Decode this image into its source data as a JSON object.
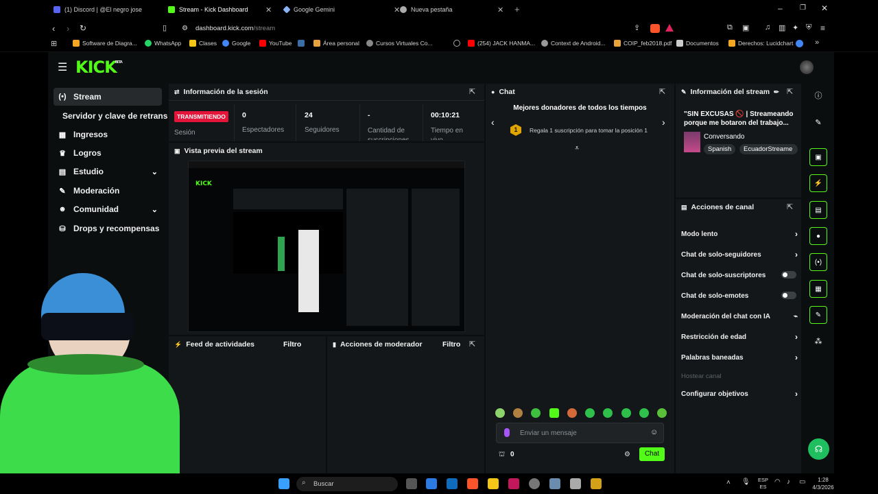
{
  "browser": {
    "tabs": [
      {
        "label": "(1) Discord | @El negro jose",
        "icon": "discord-icon",
        "color": "#5865f2"
      },
      {
        "label": "Stream - Kick Dashboard",
        "icon": "kick-icon",
        "color": "#53fc18"
      },
      {
        "label": "Google Gemini",
        "icon": "gemini-icon",
        "color": "#8ab4f8"
      },
      {
        "label": "Nueva pestaña",
        "icon": "brave-icon",
        "color": "#aaaaaa"
      }
    ],
    "url_domain": "dashboard.kick.com",
    "url_path": "/stream",
    "bookmarks": [
      {
        "label": "Software de Diagra...",
        "color": "#f5a623"
      },
      {
        "label": "WhatsApp",
        "color": "#25d366"
      },
      {
        "label": "Clases",
        "color": "#f5c518"
      },
      {
        "label": "Google",
        "color": "#4285f4"
      },
      {
        "label": "YouTube",
        "color": "#ff0000"
      },
      {
        "label": "",
        "color": "#3a6ea5"
      },
      {
        "label": "Área personal",
        "color": "#e8a33d"
      },
      {
        "label": "Cursos Virtuales Co...",
        "color": "#888888"
      },
      {
        "label": "(254) JACK HANMA...",
        "color": "#ff0000"
      },
      {
        "label": "Context de Android...",
        "color": "#999999"
      },
      {
        "label": "COIP_feb2018.pdf",
        "color": "#e8a33d"
      },
      {
        "label": "Documentos",
        "color": "#cccccc"
      },
      {
        "label": "Derechos: Lucidchart",
        "color": "#f5a623"
      }
    ]
  },
  "sidebar": {
    "items": [
      {
        "label": "Stream",
        "icon": "stream-icon",
        "glyph": "(•)"
      },
      {
        "label": "Servidor y clave de retransm",
        "icon": "",
        "glyph": ""
      },
      {
        "label": "Ingresos",
        "icon": "revenue-icon",
        "glyph": "▦"
      },
      {
        "label": "Logros",
        "icon": "trophy-icon",
        "glyph": "🏆"
      },
      {
        "label": "Estudio",
        "icon": "studio-icon",
        "glyph": "▤"
      },
      {
        "label": "Moderación",
        "icon": "wrench-icon",
        "glyph": "🔧"
      },
      {
        "label": "Comunidad",
        "icon": "community-icon",
        "glyph": "👤"
      },
      {
        "label": "Drops y recompensas",
        "icon": "drops-icon",
        "glyph": "⛁"
      }
    ]
  },
  "session": {
    "title": "Información de la sesión",
    "live_badge": "TRANSMITIENDO",
    "live_label": "Sesión",
    "stats": [
      {
        "value": "0",
        "label": "Espectadores"
      },
      {
        "value": "24",
        "label": "Seguidores"
      },
      {
        "value": "-",
        "label": "Cantidad de suscripciones"
      },
      {
        "value": "00:10:21",
        "label": "Tiempo en vivo"
      }
    ]
  },
  "preview": {
    "title": "Vista previa del stream"
  },
  "activity": {
    "title": "Feed de actividades",
    "filter": "Filtro"
  },
  "moderator": {
    "title": "Acciones de moderador",
    "filter": "Filtro"
  },
  "chat": {
    "title": "Chat",
    "donors_title": "Mejores donadores de todos los tiempos",
    "rank": "1",
    "donor_text": "Regala 1 suscripción para tomar la posición 1",
    "input_placeholder": "Enviar un mensaje",
    "points": "0",
    "send_label": "Chat"
  },
  "stream_info": {
    "title": "Información del stream",
    "stream_title": "\"SIN EXCUSAS 🚫 | Streameando porque me botaron del trabajo...",
    "category": "Conversando",
    "tags": [
      "Spanish",
      "EcuadorStreame"
    ]
  },
  "channel_actions": {
    "title": "Acciones de canal",
    "rows": [
      {
        "label": "Modo lento",
        "control": "chevron"
      },
      {
        "label": "Chat de solo-seguidores",
        "control": "chevron"
      },
      {
        "label": "Chat de solo-suscriptores",
        "control": "toggle"
      },
      {
        "label": "Chat de solo-emotes",
        "control": "toggle"
      },
      {
        "label": "Moderación del chat con IA",
        "control": "chart"
      },
      {
        "label": "Restricción de edad",
        "control": "chevron"
      },
      {
        "label": "Palabras baneadas",
        "control": "chevron"
      },
      {
        "label": "Hostear canal",
        "control": "none"
      },
      {
        "label": "Configurar objetivos",
        "control": "chevron"
      }
    ]
  },
  "taskbar": {
    "search_placeholder": "Buscar",
    "lang_top": "ESP",
    "lang_bottom": "ES",
    "time": "1:28",
    "date": "4/3/2026"
  },
  "colors": {
    "accent": "#53fc18",
    "live": "#e4153a",
    "panel": "#141719",
    "bg": "#0b0e0f"
  }
}
